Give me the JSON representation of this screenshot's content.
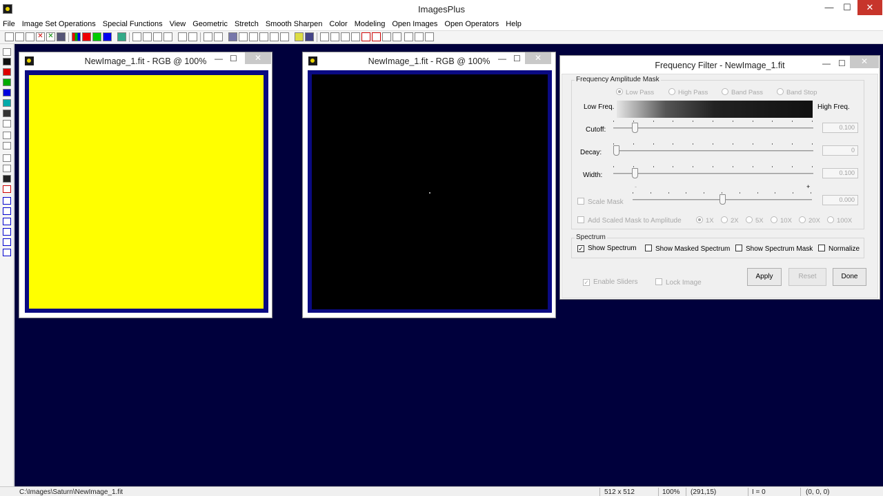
{
  "app": {
    "title": "ImagesPlus"
  },
  "menu": [
    "File",
    "Image Set Operations",
    "Special Functions",
    "View",
    "Geometric",
    "Stretch",
    "Smooth Sharpen",
    "Color",
    "Modeling",
    "Open Images",
    "Open Operators",
    "Help"
  ],
  "window_controls": {
    "minimize": "—",
    "maximize": "☐",
    "close": "✕"
  },
  "image_windows": [
    {
      "title": "NewImage_1.fit - RGB @ 100%",
      "fill": "#ffff00"
    },
    {
      "title": "NewImage_1.fit - RGB @ 100%",
      "fill": "#000000"
    }
  ],
  "dialog": {
    "title": "Frequency Filter - NewImage_1.fit",
    "mask_group": "Frequency Amplitude Mask",
    "filter_types": [
      "Low Pass",
      "High Pass",
      "Band Pass",
      "Band Stop"
    ],
    "selected_filter": "Low Pass",
    "low_freq_label": "Low Freq.",
    "high_freq_label": "High Freq.",
    "cutoff": {
      "label": "Cutoff:",
      "value": "0.100"
    },
    "decay": {
      "label": "Decay:",
      "value": "0"
    },
    "width": {
      "label": "Width:",
      "value": "0.100"
    },
    "scale_mask": {
      "label": "Scale Mask",
      "value": "0.000",
      "minus": "-",
      "plus": "+"
    },
    "add_scaled": "Add Scaled Mask to Amplitude",
    "multipliers": [
      "1X",
      "2X",
      "5X",
      "10X",
      "20X",
      "100X"
    ],
    "spectrum_group": "Spectrum",
    "show_spectrum": "Show Spectrum",
    "show_masked": "Show Masked Spectrum",
    "show_mask": "Show Spectrum Mask",
    "normalize": "Normalize",
    "enable_sliders": "Enable Sliders",
    "lock_image": "Lock Image",
    "apply": "Apply",
    "reset": "Reset",
    "done": "Done",
    "check_mark": "✓"
  },
  "status": {
    "path": "C:\\Images\\Saturn\\NewImage_1.fit",
    "size": "512 x 512",
    "zoom": "100%",
    "coords": "(291,15)",
    "intensity": "I = 0",
    "rgb": "(0, 0, 0)"
  },
  "colors": {
    "workspace": "#00003c",
    "frame": "#0a0a82",
    "close_red": "#c7352b"
  }
}
